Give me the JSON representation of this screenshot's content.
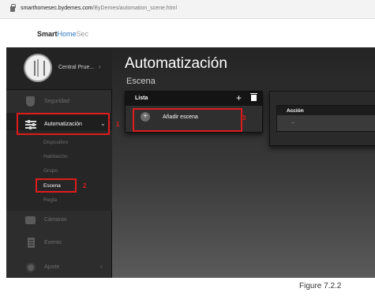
{
  "browser": {
    "url_host": "smarthomesec.bydemes.com",
    "url_path": "/ByDemes/automation_scene.html"
  },
  "brand": {
    "name_part1": "Smart",
    "name_part2": "Home",
    "name_part3": "Sec"
  },
  "sidebar": {
    "profile_name": "Central Prue...",
    "profile_chevron": "›",
    "items": [
      {
        "label": "Seguridad",
        "icon": "shield-icon"
      },
      {
        "label": "Automatización",
        "icon": "sliders-icon",
        "chevron": "⌄"
      },
      {
        "label": "Cámaras",
        "icon": "camera-icon"
      },
      {
        "label": "Evento",
        "icon": "document-icon"
      },
      {
        "label": "Ajuste",
        "icon": "gear-icon",
        "chevron": "›"
      }
    ],
    "submenu": [
      "Dispositivo",
      "Habitación",
      "Grupo",
      "Escena",
      "Regla"
    ]
  },
  "main": {
    "title": "Automatización",
    "subtitle": "Escena",
    "lista": {
      "title": "Lista",
      "add_symbol": "+",
      "add_label": "Añadir escena"
    },
    "accion": {
      "title": "Acción",
      "row": "--"
    }
  },
  "annotations": [
    "1",
    "2",
    "3"
  ],
  "caption": "Figure  7.2.2",
  "colors": {
    "accent": "#2f79c2",
    "annotation": "#e01b1b"
  }
}
